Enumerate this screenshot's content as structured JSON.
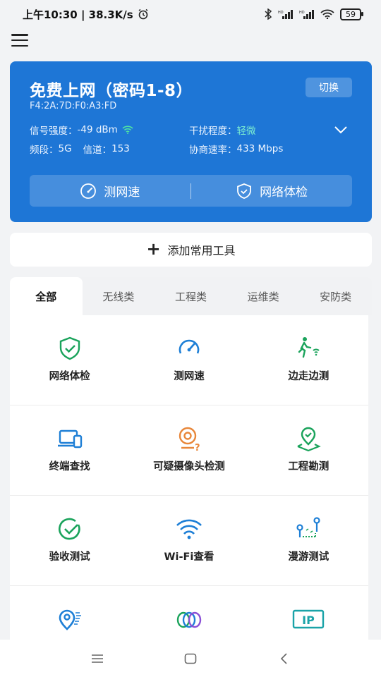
{
  "status_bar": {
    "time_speed": "上午10:30 | 38.3K/s",
    "battery": "59"
  },
  "wifi_card": {
    "ssid": "免费上网（密码1-8）",
    "mac": "F4:2A:7D:F0:A3:FD",
    "switch_label": "切换",
    "signal_label": "信号强度：",
    "signal_value": "-49 dBm",
    "interference_label": "干扰程度：",
    "interference_value": "轻微",
    "band_label": "频段：",
    "band_value": "5G",
    "channel_label": "信道：",
    "channel_value": "153",
    "rate_label": "协商速率：",
    "rate_value": "433 Mbps",
    "speed_test": "测网速",
    "network_check": "网络体检"
  },
  "add_tool": {
    "label": "添加常用工具"
  },
  "tabs": [
    "全部",
    "无线类",
    "工程类",
    "运维类",
    "安防类"
  ],
  "tools": [
    {
      "label": "网络体检",
      "icon": "shield-check-icon"
    },
    {
      "label": "测网速",
      "icon": "speedometer-icon"
    },
    {
      "label": "边走边测",
      "icon": "walking-wifi-icon"
    },
    {
      "label": "终端查找",
      "icon": "devices-icon"
    },
    {
      "label": "可疑摄像头检测",
      "icon": "camera-question-icon"
    },
    {
      "label": "工程勘测",
      "icon": "location-pin-icon"
    },
    {
      "label": "验收测试",
      "icon": "check-circle-icon"
    },
    {
      "label": "Wi-Fi查看",
      "icon": "wifi-icon"
    },
    {
      "label": "漫游测试",
      "icon": "roaming-icon"
    },
    {
      "label": "",
      "icon": "pin-signal-icon"
    },
    {
      "label": "",
      "icon": "rings-icon"
    },
    {
      "label": "",
      "icon": "ip-icon"
    }
  ],
  "colors": {
    "card_blue": "#1e76d6",
    "green": "#1aa35b",
    "blue": "#1e7fd6",
    "orange": "#e8873a"
  }
}
